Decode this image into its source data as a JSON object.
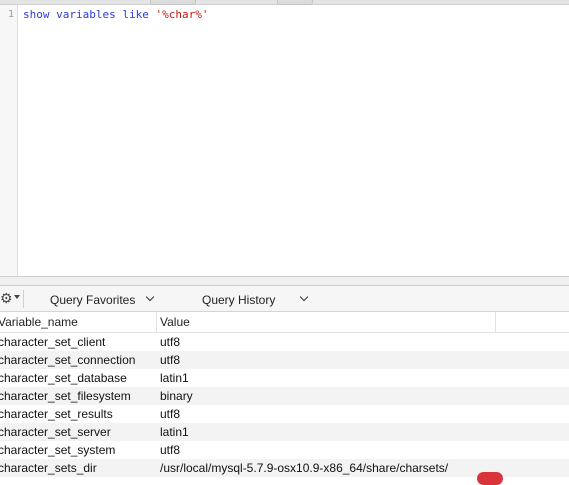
{
  "editor": {
    "line_number": "1",
    "query_keyword_show": "show",
    "query_keyword_variables": "variables",
    "query_keyword_like": "like",
    "query_string": "'%char%'"
  },
  "toolbar": {
    "gear_icon": "gear-icon",
    "query_favorites_label": "Query Favorites",
    "query_history_label": "Query History"
  },
  "results": {
    "columns": [
      "Variable_name",
      "Value"
    ],
    "rows": [
      {
        "name": "character_set_client",
        "value": "utf8"
      },
      {
        "name": "character_set_connection",
        "value": "utf8"
      },
      {
        "name": "character_set_database",
        "value": "latin1"
      },
      {
        "name": "character_set_filesystem",
        "value": "binary"
      },
      {
        "name": "character_set_results",
        "value": "utf8"
      },
      {
        "name": "character_set_server",
        "value": "latin1"
      },
      {
        "name": "character_set_system",
        "value": "utf8"
      },
      {
        "name": "character_sets_dir",
        "value": "/usr/local/mysql-5.7.9-osx10.9-x86_64/share/charsets/"
      }
    ]
  },
  "colors": {
    "keyword": "#2b3bd6",
    "string": "#c41a16",
    "row_alt": "#f3f3f3",
    "watermark_badge": "#d9343a"
  }
}
